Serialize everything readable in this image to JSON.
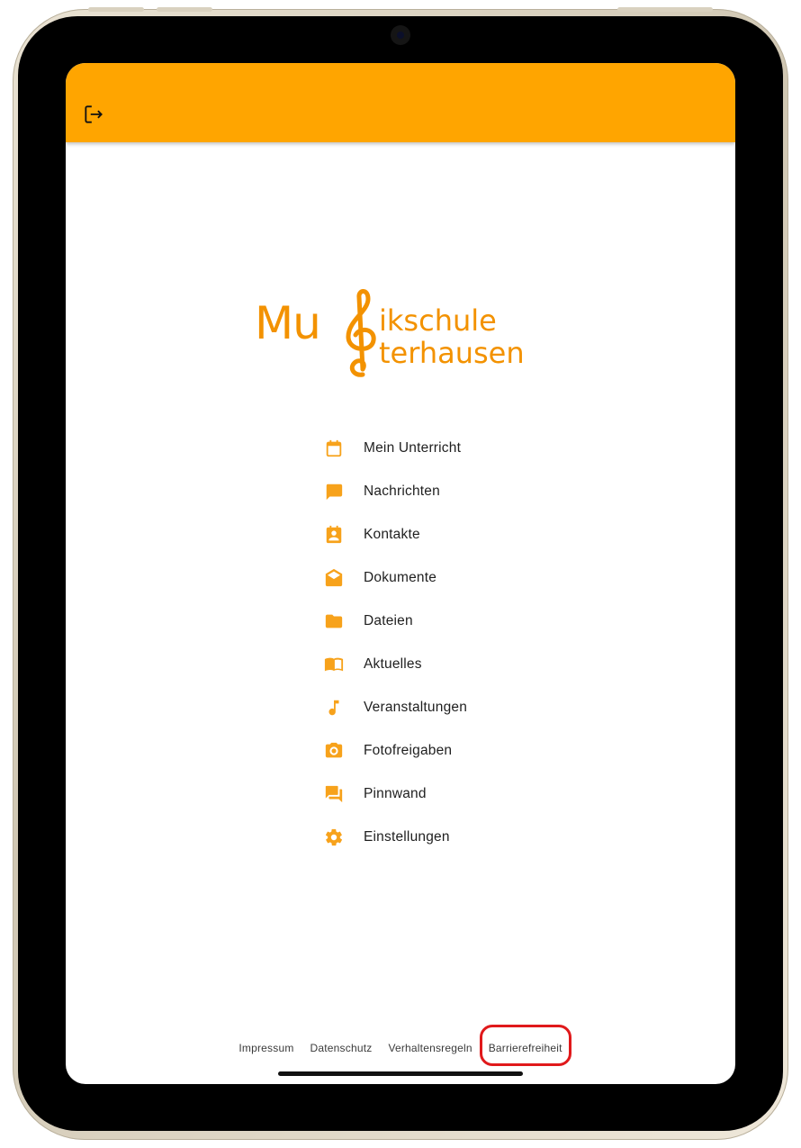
{
  "colors": {
    "accent": "#FFA500",
    "logo": "#F39200",
    "menu_icon": "#F7A21B",
    "highlight_outline": "#E0191B"
  },
  "appbar": {
    "logout_icon": "logout-icon"
  },
  "logo": {
    "part_mu": "Mu",
    "line1": "ikschule",
    "line2": "terhausen",
    "clef_icon": "treble-clef-icon"
  },
  "menu": {
    "items": [
      {
        "label": "Mein Unterricht",
        "icon": "calendar-icon"
      },
      {
        "label": "Nachrichten",
        "icon": "chat-bubble-icon"
      },
      {
        "label": "Kontakte",
        "icon": "contact-card-icon"
      },
      {
        "label": "Dokumente",
        "icon": "open-envelope-icon"
      },
      {
        "label": "Dateien",
        "icon": "folder-icon"
      },
      {
        "label": "Aktuelles",
        "icon": "open-book-icon"
      },
      {
        "label": "Veranstaltungen",
        "icon": "music-note-icon"
      },
      {
        "label": "Fotofreigaben",
        "icon": "camera-icon"
      },
      {
        "label": "Pinnwand",
        "icon": "forum-icon"
      },
      {
        "label": "Einstellungen",
        "icon": "gear-icon"
      }
    ]
  },
  "footer": {
    "links": [
      "Impressum",
      "Datenschutz",
      "Verhaltensregeln",
      "Barrierefreiheit"
    ]
  }
}
